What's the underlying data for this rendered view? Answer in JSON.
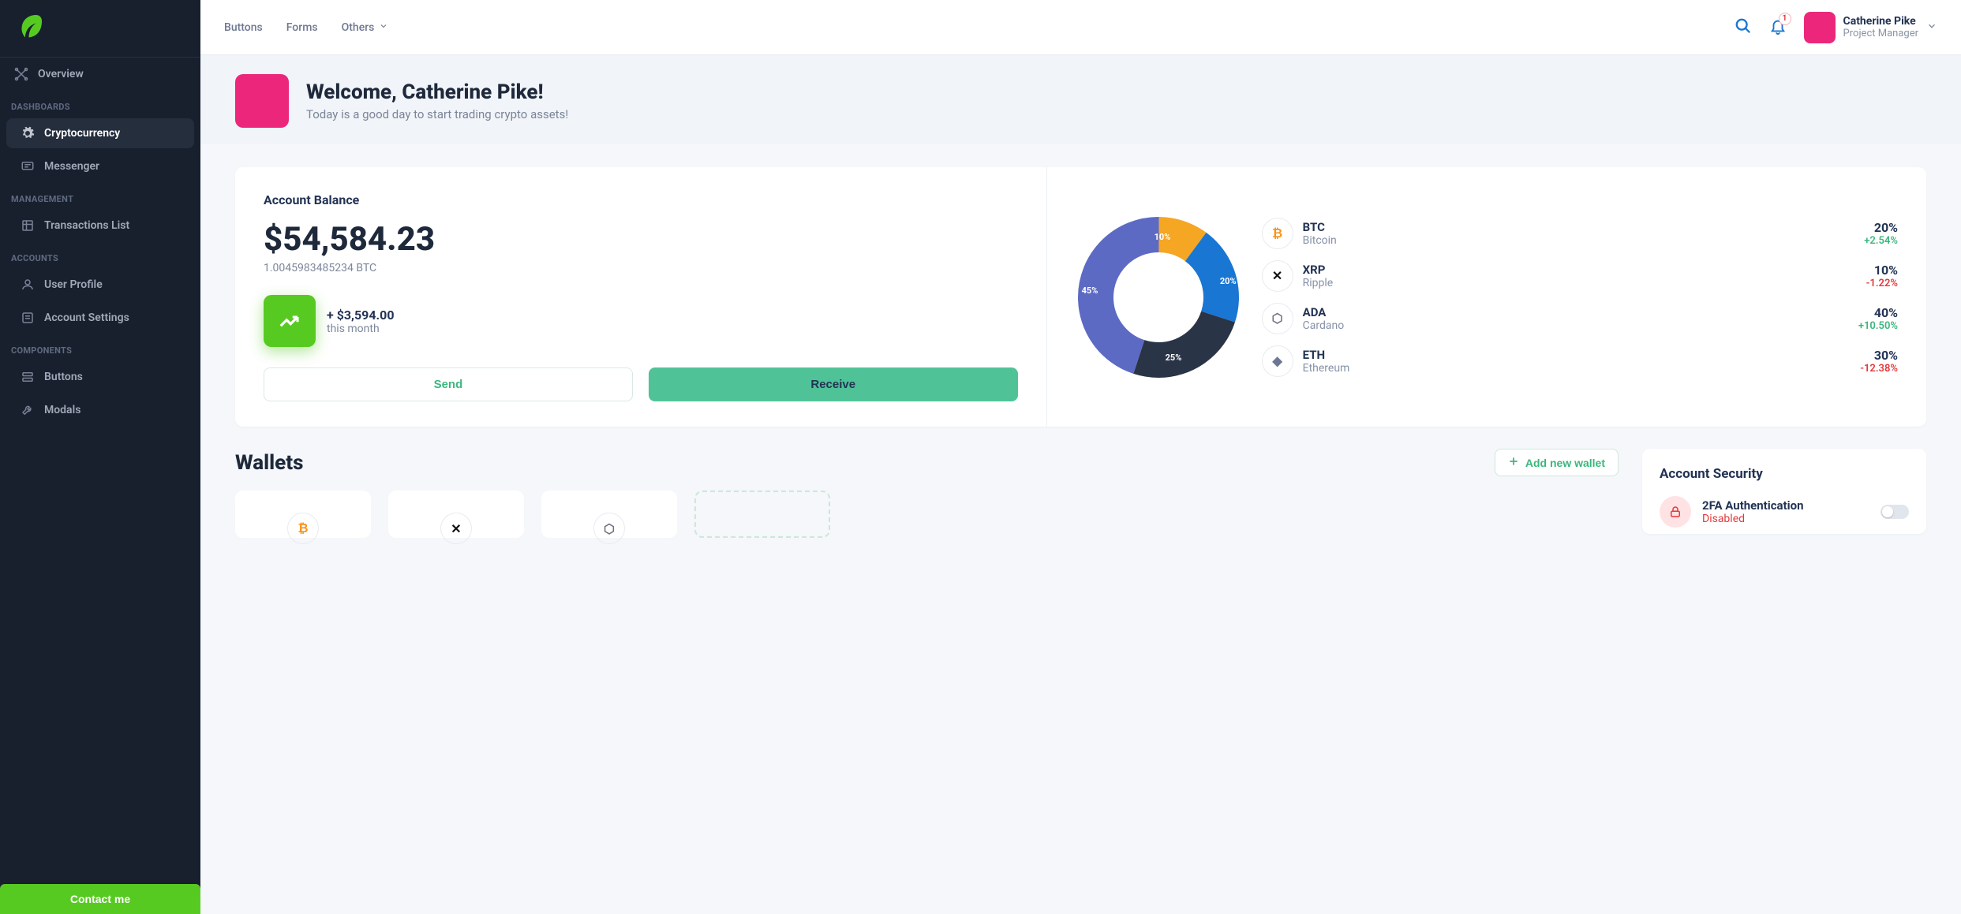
{
  "sidebar": {
    "overview": "Overview",
    "sections": [
      {
        "title": "DASHBOARDS",
        "items": [
          {
            "label": "Cryptocurrency",
            "active": true
          },
          {
            "label": "Messenger",
            "active": false
          }
        ]
      },
      {
        "title": "MANAGEMENT",
        "items": [
          {
            "label": "Transactions List",
            "active": false
          }
        ]
      },
      {
        "title": "ACCOUNTS",
        "items": [
          {
            "label": "User Profile",
            "active": false
          },
          {
            "label": "Account Settings",
            "active": false
          }
        ]
      },
      {
        "title": "COMPONENTS",
        "items": [
          {
            "label": "Buttons",
            "active": false
          },
          {
            "label": "Modals",
            "active": false
          }
        ]
      }
    ],
    "contact": "Contact me"
  },
  "topbar": {
    "links": [
      "Buttons",
      "Forms",
      "Others"
    ],
    "notif_count": "1",
    "user": {
      "name": "Catherine Pike",
      "role": "Project Manager"
    }
  },
  "hero": {
    "title": "Welcome, Catherine Pike!",
    "subtitle": "Today is a good day to start trading crypto assets!"
  },
  "balance": {
    "title": "Account Balance",
    "amount": "$54,584.23",
    "sub": "1.0045983485234 BTC",
    "trend_amount": "+ $3,594.00",
    "trend_label": "this month",
    "send": "Send",
    "receive": "Receive"
  },
  "chart_data": {
    "type": "pie",
    "labels": [
      "BTC",
      "XRP",
      "ADA",
      "ETH"
    ],
    "values": [
      20,
      10,
      40,
      30
    ],
    "display_labels": [
      "20%",
      "10%",
      "45%",
      "25%"
    ],
    "colors": [
      "#1976d2",
      "#f5a623",
      "#5c6ac4",
      "#2a3447"
    ]
  },
  "portfolio": [
    {
      "sym": "BTC",
      "name": "Bitcoin",
      "pct": "20%",
      "chg": "+2.54%",
      "dir": "pos",
      "color": "#f7931a"
    },
    {
      "sym": "XRP",
      "name": "Ripple",
      "pct": "10%",
      "chg": "-1.22%",
      "dir": "neg",
      "color": "#111"
    },
    {
      "sym": "ADA",
      "name": "Cardano",
      "pct": "40%",
      "chg": "+10.50%",
      "dir": "pos",
      "color": "#6b7280"
    },
    {
      "sym": "ETH",
      "name": "Ethereum",
      "pct": "30%",
      "chg": "-12.38%",
      "dir": "neg",
      "color": "#6c7893"
    }
  ],
  "wallets": {
    "title": "Wallets",
    "add": "Add new wallet"
  },
  "security": {
    "title": "Account Security",
    "item_title": "2FA Authentication",
    "item_status": "Disabled"
  }
}
